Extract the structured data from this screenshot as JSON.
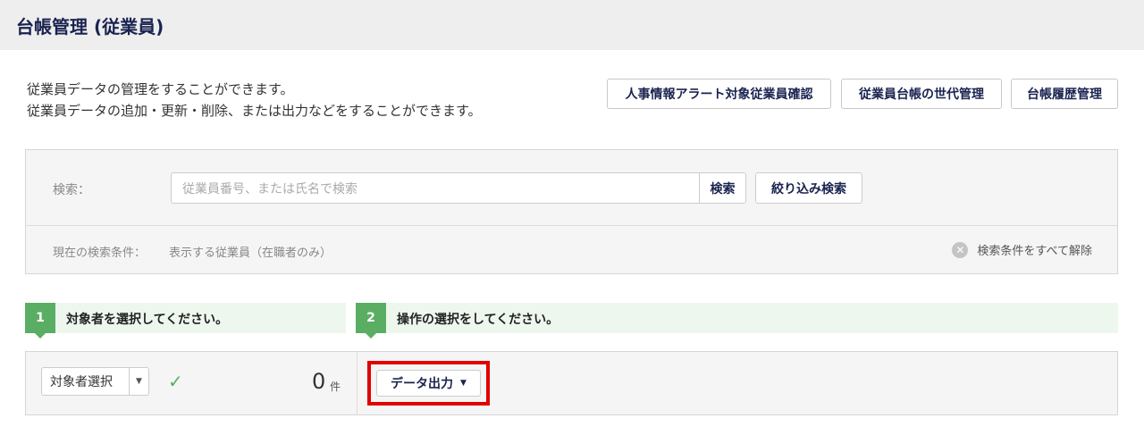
{
  "header": {
    "title": "台帳管理 (従業員)"
  },
  "description": {
    "line1": "従業員データの管理をすることができます。",
    "line2": "従業員データの追加・更新・削除、または出力などをすることができます。"
  },
  "top_buttons": {
    "alert": "人事情報アラート対象従業員確認",
    "generation": "従業員台帳の世代管理",
    "history": "台帳履歴管理"
  },
  "search": {
    "label": "検索：",
    "placeholder": "従業員番号、または氏名で検索",
    "search_button": "検索",
    "refine_button": "絞り込み検索",
    "condition_label": "現在の検索条件：",
    "condition_value": "表示する従業員（在職者のみ）",
    "clear_all": "検索条件をすべて解除"
  },
  "steps": [
    {
      "number": "1",
      "text": "対象者を選択してください。"
    },
    {
      "number": "2",
      "text": "操作の選択をしてください。"
    }
  ],
  "operations": {
    "target_select_label": "対象者選択",
    "count": "0",
    "count_unit": "件",
    "export_button": "データ出力"
  },
  "icons": {
    "clear": "clear-circle-icon",
    "check": "check-icon",
    "caret": "caret-down-icon"
  },
  "colors": {
    "accent_navy": "#1a2350",
    "step_green": "#5aae63",
    "highlight_red": "#e00000"
  }
}
